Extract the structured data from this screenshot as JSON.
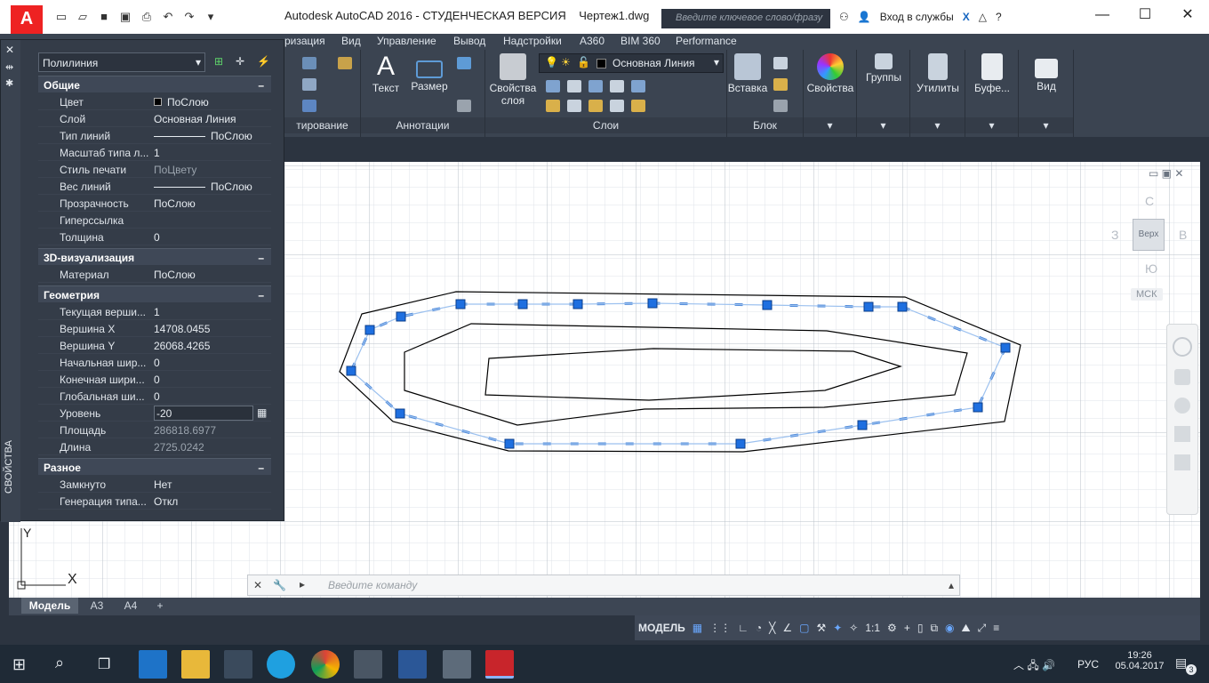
{
  "window": {
    "title": "Autodesk AutoCAD 2016 - СТУДЕНЧЕСКАЯ ВЕРСИЯ    Чертеж1.dwg",
    "search_placeholder": "Введите ключевое слово/фразу",
    "signin": "Вход в службы",
    "help": "?"
  },
  "menubar": {
    "items": [
      "ризация",
      "Вид",
      "Управление",
      "Вывод",
      "Надстройки",
      "A360",
      "BIM 360",
      "Performance"
    ]
  },
  "ribbon": {
    "panels": {
      "edit_title": "тирование",
      "annotations_title": "Аннотации",
      "layers_title": "Слои",
      "block_title": "Блок"
    },
    "buttons": {
      "text": "Текст",
      "dimension": "Размер",
      "layer_props_1": "Свойства",
      "layer_props_2": "слоя",
      "insert": "Вставка",
      "properties": "Свойства",
      "groups": "Группы",
      "utilities": "Утилиты",
      "clipboard": "Буфе...",
      "view": "Вид"
    },
    "layer_combo": "Основная Линия"
  },
  "properties_palette": {
    "side_title": "СВОЙСТВА",
    "object_type": "Полилиния",
    "sections": {
      "general": {
        "title": "Общие",
        "rows": [
          {
            "key": "Цвет",
            "value": "ПоСлою"
          },
          {
            "key": "Слой",
            "value": "Основная Линия"
          },
          {
            "key": "Тип линий",
            "value": "ПоСлою"
          },
          {
            "key": "Масштаб типа л...",
            "value": "1"
          },
          {
            "key": "Стиль печати",
            "value": "ПоЦвету"
          },
          {
            "key": "Вес линий",
            "value": "ПоСлою"
          },
          {
            "key": "Прозрачность",
            "value": "ПоСлою"
          },
          {
            "key": "Гиперссылка",
            "value": ""
          },
          {
            "key": "Толщина",
            "value": "0"
          }
        ]
      },
      "viz3d": {
        "title": "3D-визуализация",
        "rows": [
          {
            "key": "Материал",
            "value": "ПоСлою"
          }
        ]
      },
      "geometry": {
        "title": "Геометрия",
        "rows": [
          {
            "key": "Текущая верши...",
            "value": "1"
          },
          {
            "key": "Вершина X",
            "value": "14708.0455"
          },
          {
            "key": "Вершина Y",
            "value": "26068.4265"
          },
          {
            "key": "Начальная шир...",
            "value": "0"
          },
          {
            "key": "Конечная шири...",
            "value": "0"
          },
          {
            "key": "Глобальная ши...",
            "value": "0"
          },
          {
            "key": "Уровень",
            "value": "-20"
          },
          {
            "key": "Площадь",
            "value": "286818.6977"
          },
          {
            "key": "Длина",
            "value": "2725.0242"
          }
        ]
      },
      "misc": {
        "title": "Разное",
        "rows": [
          {
            "key": "Замкнуто",
            "value": "Нет"
          },
          {
            "key": "Генерация типа...",
            "value": "Откл"
          }
        ]
      }
    }
  },
  "viewcube": {
    "north": "С",
    "south": "Ю",
    "west": "З",
    "east": "В",
    "top": "Верх",
    "ucs": "МСК"
  },
  "command_line": {
    "placeholder": "Введите команду"
  },
  "ucs_icon": {
    "x_label": "X",
    "y_label": "Y"
  },
  "layout_tabs": [
    "Модель",
    "А3",
    "А4",
    "+"
  ],
  "statusbar": {
    "model": "МОДЕЛЬ",
    "scale": "1:1"
  },
  "taskbar": {
    "lang": "РУС",
    "time": "19:26",
    "date": "05.04.2017",
    "notifications": "3"
  }
}
